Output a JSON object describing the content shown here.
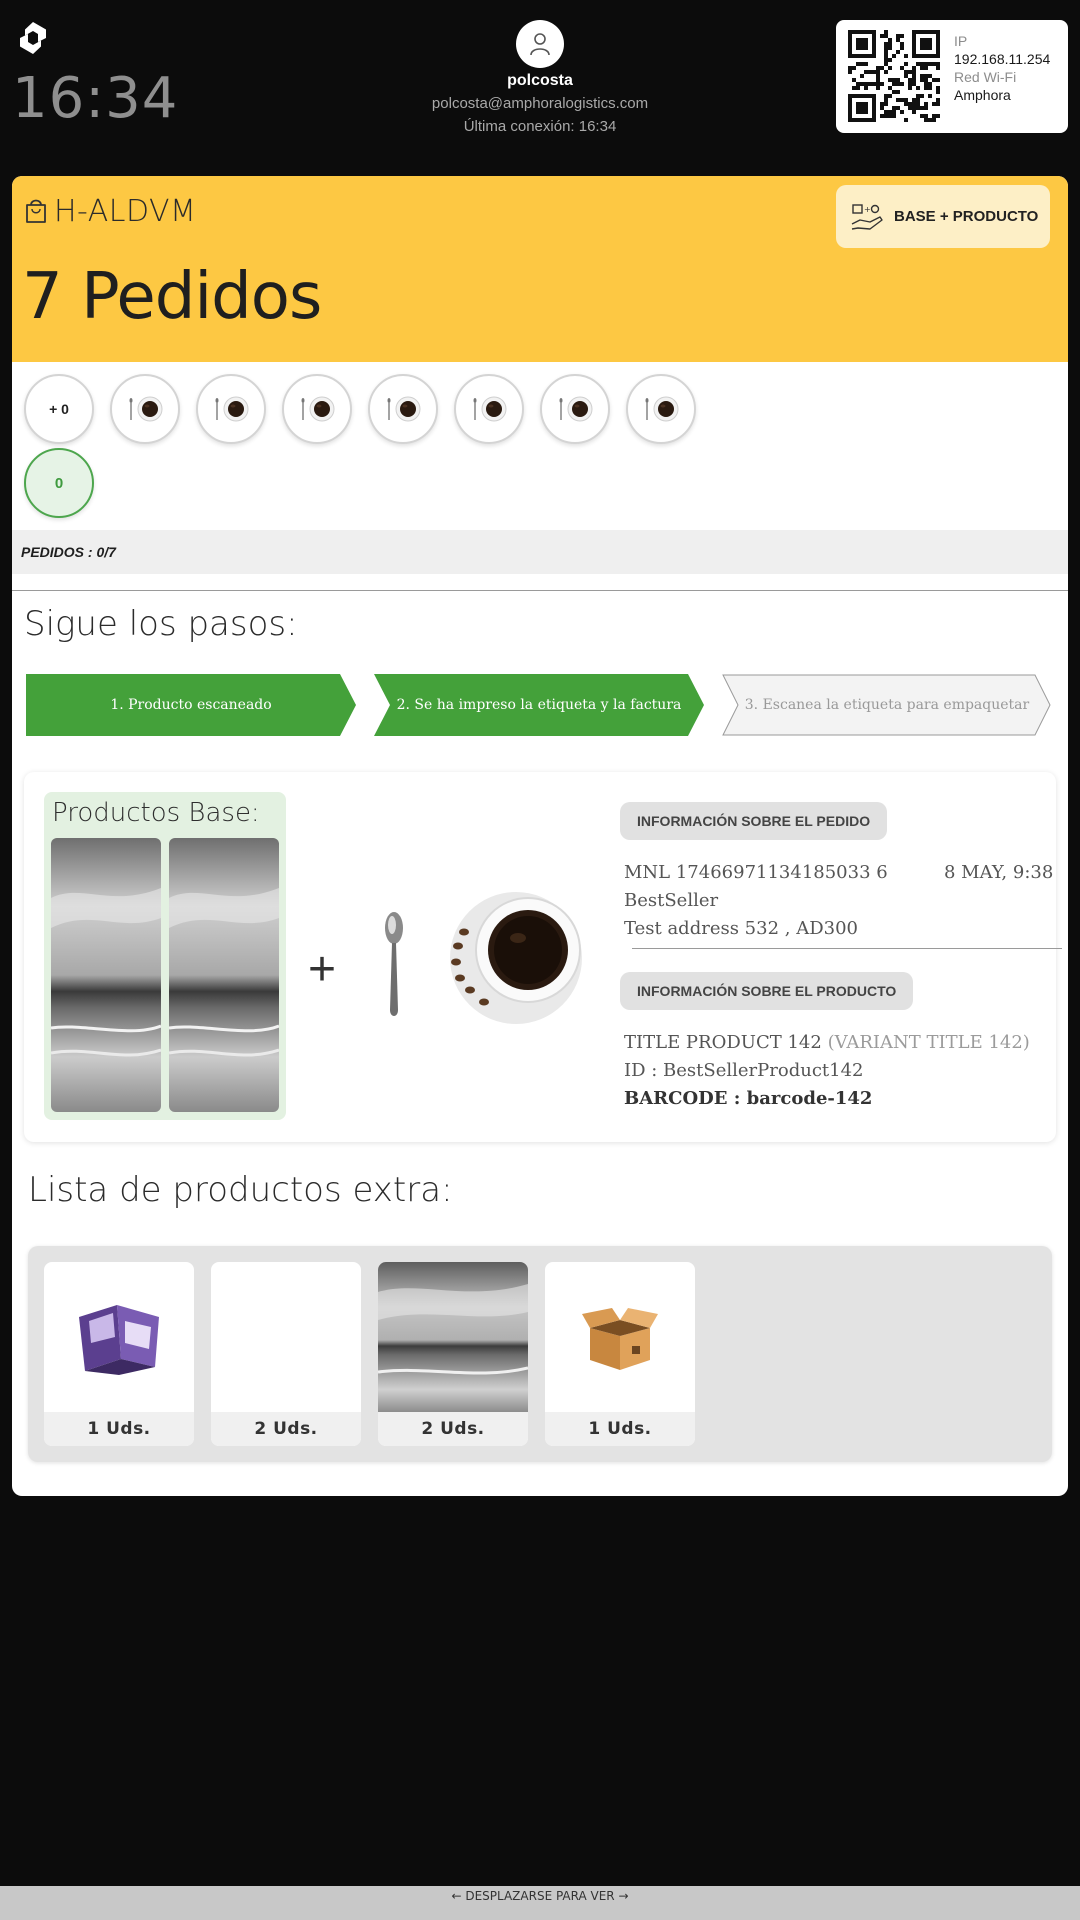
{
  "header": {
    "clock": "16:34",
    "user": {
      "name": "polcosta",
      "email": "polcosta@amphoralogistics.com",
      "last_connection": "Última conexión: 16:34"
    },
    "network": {
      "ip_label": "IP",
      "ip_value": "192.168.11.254",
      "wifi_label": "Red Wi-Fi",
      "wifi_value": "Amphora"
    }
  },
  "order": {
    "id": "H-ALDVM",
    "count_title": "7 Pedidos",
    "mode_button": "BASE + PRODUCTO",
    "circles": [
      {
        "label": "+ 0",
        "icon": "plus-counter"
      },
      {
        "icon": "coffee-spoon-icon"
      },
      {
        "icon": "coffee-spoon-icon"
      },
      {
        "icon": "coffee-spoon-icon"
      },
      {
        "icon": "coffee-spoon-icon"
      },
      {
        "icon": "coffee-spoon-icon"
      },
      {
        "icon": "coffee-spoon-icon"
      },
      {
        "icon": "coffee-spoon-icon"
      },
      {
        "label": "0",
        "icon": "green-counter"
      }
    ],
    "progress_label": "PEDIDOS : 0/7"
  },
  "steps": {
    "title": "Sigue los pasos:",
    "items": [
      {
        "label": "1. Producto escaneado",
        "state": "done"
      },
      {
        "label": "2. Se ha impreso la etiqueta y la factura",
        "state": "done"
      },
      {
        "label": "3. Escanea la etiqueta para empaquetar",
        "state": "pending"
      }
    ],
    "colors": {
      "done": "#44a13a",
      "pending": "#f3f3f3"
    }
  },
  "product": {
    "base_title": "Productos Base:",
    "plus": "+",
    "order_info_title": "INFORMACIÓN SOBRE EL PEDIDO",
    "order_number": "MNL 17466971134185033 6",
    "order_date": "8 MAY, 9:38",
    "seller": "BestSeller",
    "address": "Test address 532 , AD300",
    "product_info_title": "INFORMACIÓN SOBRE EL PRODUCTO",
    "product_title": "TITLE PRODUCT 142",
    "variant_title": "(VARIANT TITLE 142)",
    "product_id": "ID : BestSellerProduct142",
    "barcode_label": "BARCODE : ",
    "barcode_value": "barcode-142"
  },
  "extras": {
    "title": "Lista de productos extra:",
    "items": [
      {
        "qty": "1 Uds.",
        "thumb": "brochure"
      },
      {
        "qty": "2 Uds.",
        "thumb": "blank"
      },
      {
        "qty": "2 Uds.",
        "thumb": "beach-photo"
      },
      {
        "qty": "1 Uds.",
        "thumb": "cardboard-box"
      }
    ]
  },
  "footer": {
    "scroll_hint": "← DESPLAZARSE PARA VER →"
  },
  "colors": {
    "header_yellow": "#fdc843",
    "button_cream": "#fdefc6",
    "step_green": "#44a13a",
    "base_green_bg": "#e3f1e1"
  }
}
